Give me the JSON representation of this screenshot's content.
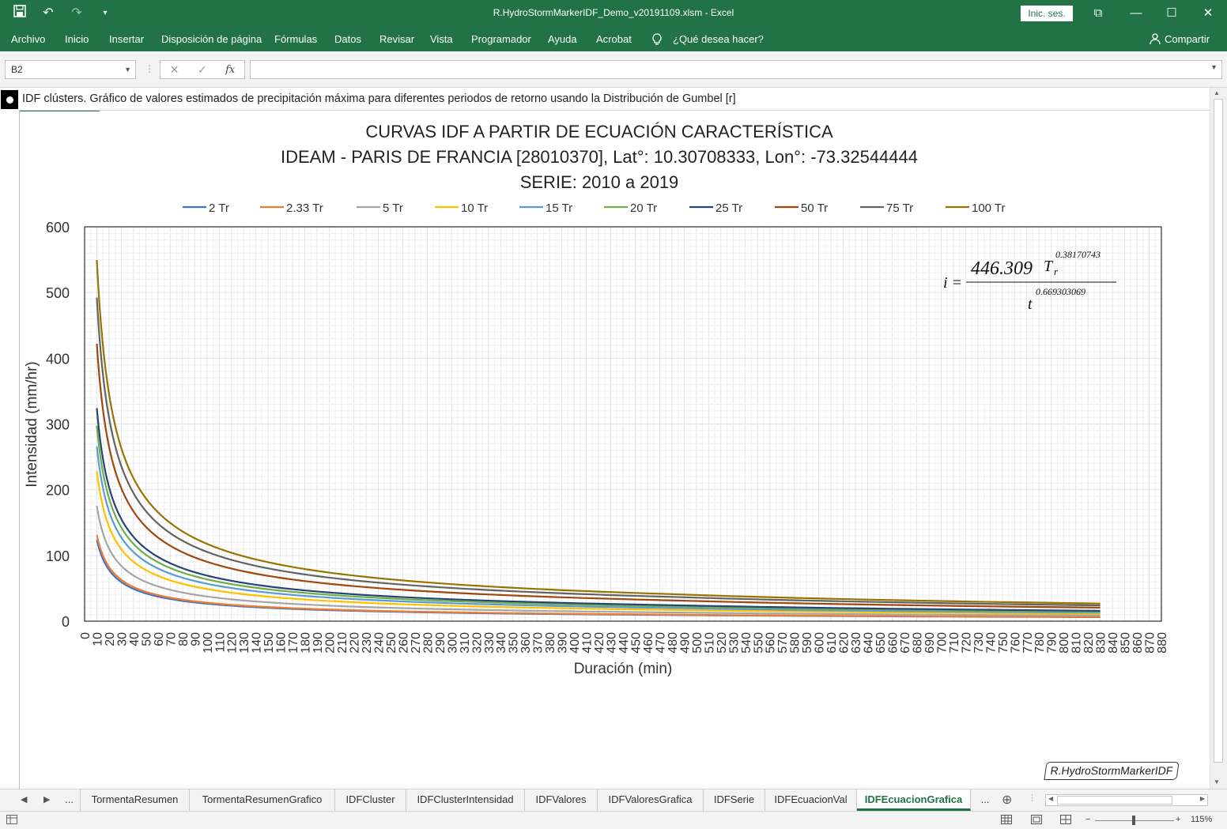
{
  "titlebar": {
    "doc_title": "R.HydroStormMarkerIDF_Demo_v20191109.xlsm  -  Excel",
    "signin": "Inic. ses."
  },
  "menu": [
    {
      "label": "Archivo"
    },
    {
      "label": "Inicio"
    },
    {
      "label": "Insertar"
    },
    {
      "label": "Disposición de página"
    },
    {
      "label": "Fórmulas"
    },
    {
      "label": "Datos"
    },
    {
      "label": "Revisar"
    },
    {
      "label": "Vista"
    },
    {
      "label": "Programador"
    },
    {
      "label": "Ayuda"
    },
    {
      "label": "Acrobat"
    },
    {
      "label": "¿Qué desea hacer?"
    },
    {
      "label": "Compartir"
    }
  ],
  "formula_bar": {
    "name_box": "B2",
    "fx": "fx",
    "value": ""
  },
  "sheet": {
    "description": "IDF clústers. Gráfico de valores estimados de precipitación máxima para diferentes periodos de retorno usando la Distribución de Gumbel [r]"
  },
  "chart_data": {
    "type": "line",
    "title_lines": [
      "CURVAS IDF A PARTIR DE ECUACIÓN CARACTERÍSTICA",
      "IDEAM - PARIS DE FRANCIA [28010370], Lat°: 10.30708333, Lon°: -73.32544444",
      "SERIE: 2010 a 2019"
    ],
    "xlabel": "Duración (min)",
    "ylabel": "Intensidad (mm/hr)",
    "xlim": [
      0,
      880
    ],
    "ylim": [
      0,
      600
    ],
    "x_ticks": [
      0,
      10,
      20,
      30,
      40,
      50,
      60,
      70,
      80,
      90,
      100,
      110,
      120,
      130,
      140,
      150,
      160,
      170,
      180,
      190,
      200,
      210,
      220,
      230,
      240,
      250,
      260,
      270,
      280,
      290,
      300,
      310,
      320,
      330,
      340,
      350,
      360,
      370,
      380,
      390,
      400,
      410,
      420,
      430,
      440,
      450,
      460,
      470,
      480,
      490,
      500,
      510,
      520,
      530,
      540,
      550,
      560,
      570,
      580,
      590,
      600,
      610,
      620,
      630,
      640,
      650,
      660,
      670,
      680,
      690,
      700,
      710,
      720,
      730,
      740,
      750,
      760,
      770,
      780,
      790,
      800,
      810,
      820,
      830,
      840,
      850,
      860,
      870,
      880
    ],
    "y_ticks": [
      0,
      100,
      200,
      300,
      400,
      500,
      600
    ],
    "grid": true,
    "legend_position": "top",
    "x": [
      10,
      20,
      30,
      60,
      120,
      240,
      480,
      830
    ],
    "series": [
      {
        "name": "2 Tr",
        "color": "#4472C4",
        "values": [
          123.9,
          77.9,
          59.4,
          37.4,
          23.5,
          14.8,
          9.3,
          6.1
        ]
      },
      {
        "name": "2.33 Tr",
        "color": "#ED7D31",
        "values": [
          131.3,
          82.5,
          62.9,
          39.6,
          24.9,
          15.7,
          9.9,
          6.4
        ]
      },
      {
        "name": "5 Tr",
        "color": "#A5A5A5",
        "values": [
          175.4,
          110.3,
          84.1,
          52.9,
          33.2,
          20.9,
          13.2,
          8.6
        ]
      },
      {
        "name": "10 Tr",
        "color": "#FFC000",
        "values": [
          228.4,
          143.6,
          109.5,
          68.9,
          43.3,
          27.2,
          17.1,
          11.2
        ]
      },
      {
        "name": "15 Tr",
        "color": "#5B9BD5",
        "values": [
          265.8,
          167.1,
          127.4,
          80.1,
          50.4,
          31.7,
          19.9,
          13.0
        ]
      },
      {
        "name": "20 Tr",
        "color": "#70AD47",
        "values": [
          297.3,
          186.9,
          142.5,
          89.6,
          56.3,
          35.4,
          22.3,
          14.5
        ]
      },
      {
        "name": "25 Tr",
        "color": "#264478",
        "values": [
          324.1,
          203.8,
          155.4,
          97.7,
          61.4,
          38.6,
          24.3,
          15.8
        ]
      },
      {
        "name": "50 Tr",
        "color": "#9E480E",
        "values": [
          422.1,
          265.4,
          202.3,
          127.2,
          80.0,
          50.3,
          31.6,
          20.6
        ]
      },
      {
        "name": "75 Tr",
        "color": "#636363",
        "values": [
          492.3,
          309.5,
          236.0,
          148.4,
          93.3,
          58.6,
          36.9,
          24.0
        ]
      },
      {
        "name": "100 Tr",
        "color": "#997300",
        "values": [
          549.5,
          345.5,
          263.4,
          165.6,
          104.1,
          65.4,
          41.1,
          26.8
        ]
      }
    ],
    "equation": {
      "lhs": "i =",
      "coef": "446.309",
      "tr": "T",
      "tr_sub": "r",
      "tr_exp": "0.38170743",
      "den": "t",
      "den_exp": "0.669303069"
    },
    "watermark": "R.HydroStormMarkerIDF"
  },
  "tabs": [
    {
      "label": "..."
    },
    {
      "label": "TormentaResumen"
    },
    {
      "label": "TormentaResumenGrafico"
    },
    {
      "label": "IDFCluster"
    },
    {
      "label": "IDFClusterIntensidad"
    },
    {
      "label": "IDFValores"
    },
    {
      "label": "IDFValoresGrafica"
    },
    {
      "label": "IDFSerie"
    },
    {
      "label": "IDFEcuacionVal"
    },
    {
      "label": "IDFEcuacionGrafica"
    },
    {
      "label": "..."
    }
  ],
  "status": {
    "zoom": "115%"
  }
}
